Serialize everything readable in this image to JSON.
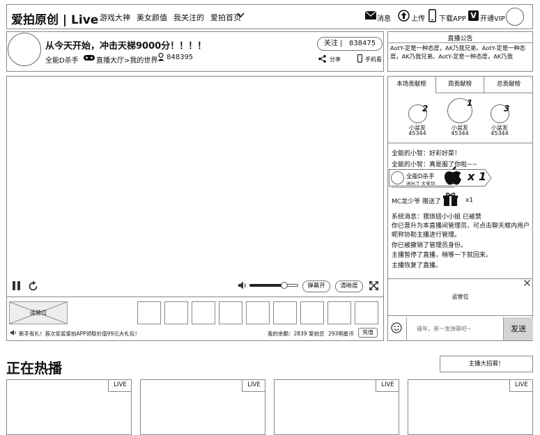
{
  "topbar": {
    "logo": "爱拍原创 | Live",
    "nav": [
      "游戏大神",
      "美女颜值",
      "我关注的",
      "爱拍首页"
    ],
    "actions": {
      "message": "消息",
      "upload": "上传",
      "download": "下载APP",
      "vip_badge": "V",
      "vip": "开通VIP"
    }
  },
  "room": {
    "title": "从今天开始，冲击天梯9000分！！！！",
    "host": "全能D杀手",
    "breadcrumb": "直播大厅>我的世界",
    "viewers": "848395",
    "follow_label": "关注",
    "follow_count": "838475",
    "share": "分享",
    "mobile": "手机看"
  },
  "announcement": {
    "title": "直播公告",
    "text": "AotY-定是一种态度，AK乃我兄弟。AotY-定是一种态度，AK乃我兄弟。AotY-定是一种态度，AK乃我"
  },
  "player": {
    "danmu_btn": "弹幕开",
    "quality_btn": "清晰度",
    "volume": 0.75
  },
  "ad": {
    "label": "运营位"
  },
  "bottom_bar": {
    "promo": "新手有礼！首次安装爱拍APP领取价值99元大礼包！",
    "balance": "我的余额：2839 爱拍豆",
    "stars": "293明星币",
    "recharge": "充值"
  },
  "rank": {
    "tabs": [
      "本场贡献榜",
      "周贡献榜",
      "总贡献榜"
    ],
    "entries": [
      {
        "rank": "2",
        "name": "小盆友",
        "score": "45344"
      },
      {
        "rank": "1",
        "name": "小盆友",
        "score": "45344"
      },
      {
        "rank": "3",
        "name": "小盆友",
        "score": "45344"
      }
    ]
  },
  "chat": {
    "m1": "全能的小智：好彩好菜！",
    "m2": "全能的小智：真是服了你啦~~",
    "gift_user": "全能D杀手",
    "gift_desc": "送出了 大宝剑",
    "gift_count": "x 1",
    "gift2_text": "MC龙少爷 赠送了",
    "gift2_count": "x1",
    "sys1": "系统消息：猥琐妞小小姐 已被禁",
    "sys2": "你已晋升为本直播间管理员，可点击聊天框内用户昵称协助主播进行管理。",
    "sys3": "你已被撤销了管理员身份。",
    "sys4": "主播暂停了直播，稍等一下就回来。",
    "sys5": "主播恢复了直播。"
  },
  "side_ad": {
    "label": "运营位"
  },
  "chat_input": {
    "placeholder": "骚年。来一发弹幕吧~",
    "send": "发送"
  },
  "hot": {
    "title": "正在热播",
    "recruit": "主播大招募！",
    "cards": [
      "LIVE",
      "LIVE",
      "LIVE",
      "LIVE"
    ]
  }
}
